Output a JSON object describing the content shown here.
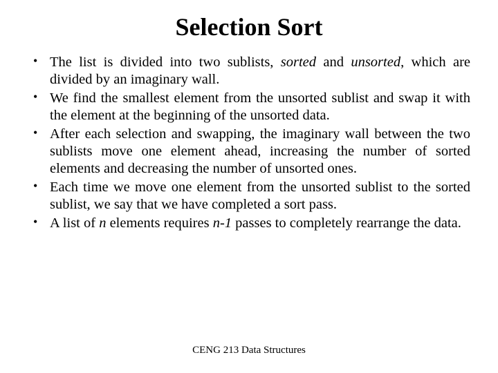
{
  "title": "Selection Sort",
  "bullets": [
    {
      "pre": "The list is divided into two sublists, ",
      "em1": "sorted",
      "mid1": " and ",
      "em2": "unsorted",
      "post": ", which are divided by an imaginary wall."
    },
    {
      "plain": "We find the smallest element from the unsorted sublist and swap it with the element at the beginning of the unsorted data."
    },
    {
      "plain": "After each selection and swapping, the imaginary wall between the two sublists move one element ahead, increasing the number of sorted elements and decreasing the number of unsorted ones."
    },
    {
      "plain": "Each time we move one element from the unsorted sublist to the sorted sublist, we say that we have completed a sort pass."
    },
    {
      "pre": "A list of ",
      "em1": "n",
      "mid1": " elements requires ",
      "em2": "n-1",
      "post": " passes to completely rearrange the data."
    }
  ],
  "footer": "CENG 213 Data Structures"
}
